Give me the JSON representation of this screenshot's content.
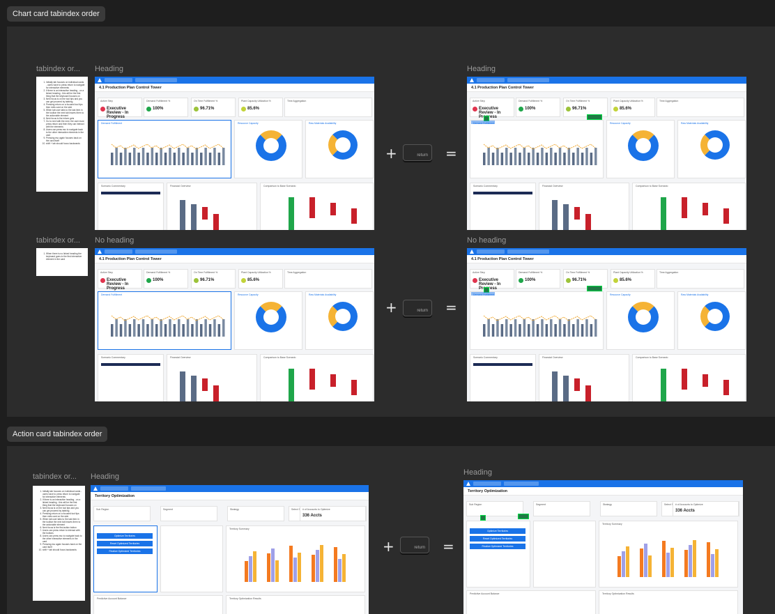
{
  "sections": {
    "chart": {
      "title": "Chart card tabindex order"
    },
    "action": {
      "title": "Action card tabindex order"
    }
  },
  "labels": {
    "tabindex": "tabindex or...",
    "heading": "Heading",
    "no_heading": "No heading"
  },
  "operators": {
    "plus": "+",
    "equals": "="
  },
  "return_key": {
    "label": "return"
  },
  "dashboard": {
    "title": "4.1 Production Plan Control Tower",
    "kpis": [
      {
        "label": "Active Step",
        "value": "Executive Review - In Progress",
        "color": "#e0344e"
      },
      {
        "label": "Demand Fulfillment %",
        "value": "100%",
        "color": "#1fa64a"
      },
      {
        "label": "On Time Fulfillment %",
        "value": "96.71%",
        "color": "#9cc33a"
      },
      {
        "label": "Plant Capacity Utilization %",
        "value": "85.6%",
        "color": "#c2d33a"
      },
      {
        "label": "Time Aggregation",
        "value": ""
      }
    ],
    "cards": {
      "demand": "Demand Fulfillment",
      "resource": "Resource Capacity",
      "raw": "Raw Materials Availability",
      "commentary": "Scenario Commentary",
      "financial": "Financial Overview",
      "comparison": "Comparison to Base Scenario"
    }
  },
  "territory": {
    "title": "Territory Optimization",
    "fields": [
      "Sub Region",
      "Segment",
      "Strategy",
      "Select Scoring Method",
      "# of Accounts to Optimize"
    ],
    "accounts_value": "336 Accts",
    "buttons": [
      "Optimize Territories",
      "Reset Optimized Territories",
      "Finalize Optimized Territories"
    ],
    "cards": {
      "summary": "Territory Summary",
      "predictive": "Predictive Account Balance",
      "results": "Territory Optimization Results"
    }
  },
  "notes": {
    "chart_heading": [
      "Initially tab focuses on individual cards - users have to press return to navigate for interactive elements",
      "If there is an interactive heading - on a linked heading - this will be the first thing that the keyboard focuses on",
      "Next focus is on the tool tips and you can get proceed by tabbing",
      "Pressing return on a focused tool tips then exits card on the side",
      "When tab user tabs to the last item in the toolbar the next tab leaves them to the actionable element",
      "Next focus is the inform gets",
      "Go to next with the next, the user must press return and then they can interact with the elements",
      "Users can press esc to navigate back to the other interactive elements in the card",
      "Pressing esc again focuses back on the card itself",
      "shift + tab should focus backwards"
    ],
    "chart_no_heading": [
      "When there is no linked heading the keyboard goes to the first interactive element in the card"
    ],
    "action_heading": [
      "Initially tab focuses on individual cards - users have to press return to navigate for interactive elements",
      "If there is an interactive heading - on a linked heading - this will be the first thing that the keyboard focuses on",
      "Next focus is on the tool tips and you can get proceed by tabbing",
      "Pressing return on a focused tool tips then exits card on the side",
      "When tab user tabs to the last item in the toolbar the next tab leaves them to the actionable element",
      "Next focus is the first action button",
      "Users can press return to interact with the buttons",
      "Users can press esc to navigate back to the other interactive elements in the card",
      "Pressing esc again focuses back on the card itself",
      "shift + tab should focus backwards"
    ]
  }
}
